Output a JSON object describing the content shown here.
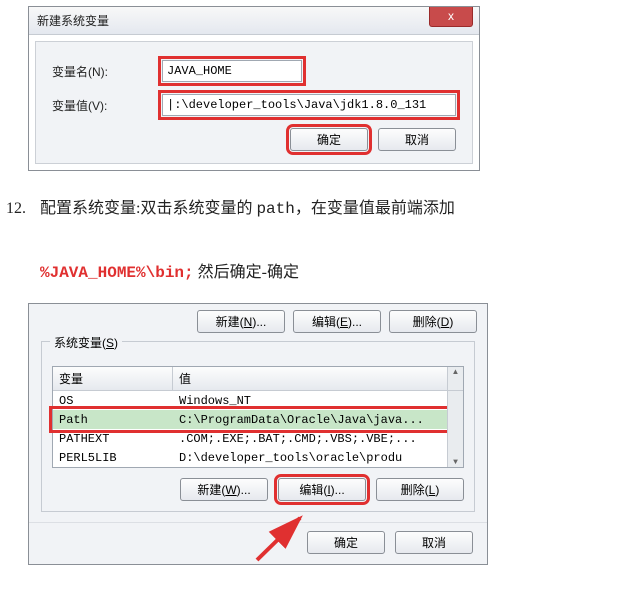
{
  "dialog1": {
    "title": "新建系统变量",
    "name_label": "变量名(N):",
    "value_label": "变量值(V):",
    "name_value": "JAVA_HOME",
    "value_value": "|:\\developer_tools\\Java\\jdk1.8.0_131",
    "ok": "确定",
    "cancel": "取消",
    "close": "x"
  },
  "step": {
    "num": "12.",
    "text1_pre": "配置系统变量:双击系统变量的 ",
    "text1_path": "path",
    "text1_post": "，在变量值最前端添加",
    "red": "%JAVA_HOME%\\bin;",
    "text2": " 然后确定-确定"
  },
  "dialog2": {
    "top_new": "新建(N)...",
    "top_edit": "编辑(E)...",
    "top_del": "删除(D)...",
    "group_title": "系统变量(S)",
    "col_var": "变量",
    "col_val": "值",
    "rows": [
      {
        "name": "OS",
        "value": "Windows_NT"
      },
      {
        "name": "Path",
        "value": "C:\\ProgramData\\Oracle\\Java\\java..."
      },
      {
        "name": "PATHEXT",
        "value": ".COM;.EXE;.BAT;.CMD;.VBS;.VBE;..."
      },
      {
        "name": "PERL5LIB",
        "value": "D:\\developer_tools\\oracle\\produ"
      }
    ],
    "btn_new": "新建(W)...",
    "btn_edit": "编辑(I)...",
    "btn_del": "删除(L)",
    "ok": "确定",
    "cancel": "取消"
  }
}
